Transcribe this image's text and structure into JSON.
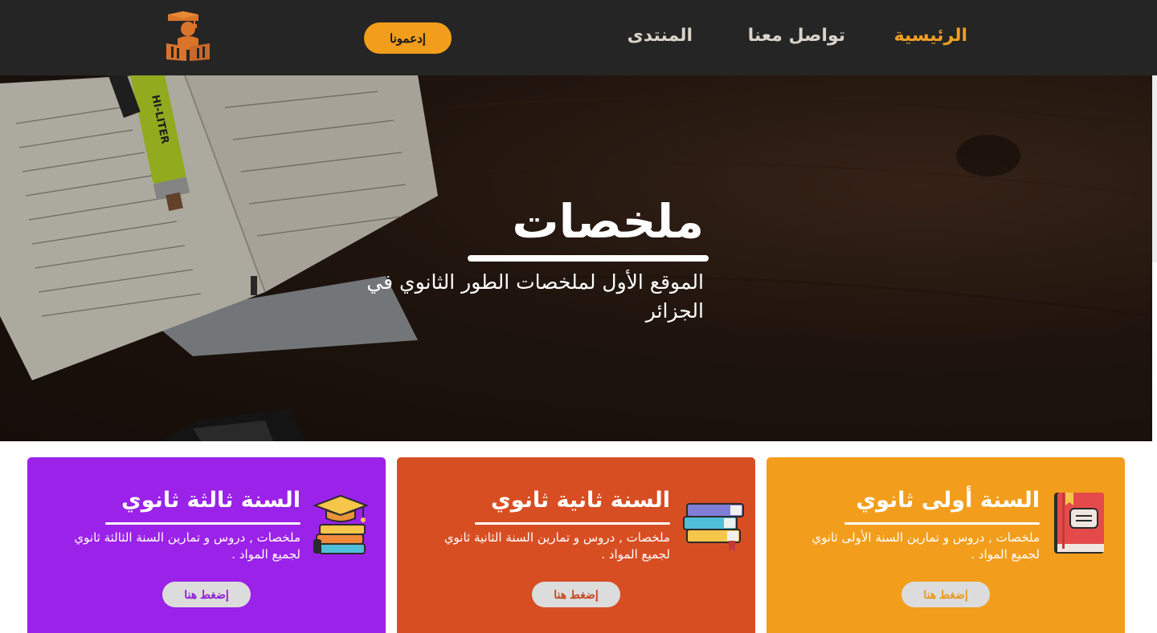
{
  "nav": {
    "home": "الرئيسية",
    "contact": "تواصل معنا",
    "forum": "المنتدى",
    "support_button": "إدعمونا",
    "logo_icon": "graduate-books-logo-icon"
  },
  "hero": {
    "title": "ملخصات",
    "subtitle": "الموقع الأول لملخصات الطور الثانوي في الجزائر",
    "highlighter_text": "HI-LITER"
  },
  "cards": [
    {
      "title": "السنة أولى ثانوي",
      "description": "ملخصات , دروس و تمارين السنة الأولى ثانوي لجميع المواد .",
      "button": "إضغط هنا",
      "icon": "book-icon",
      "color": "#f29e1c"
    },
    {
      "title": "السنة ثانية ثانوي",
      "description": "ملخصات , دروس و تمارين السنة الثانية ثانوي لجميع المواد .",
      "button": "إضغط هنا",
      "icon": "books-stack-icon",
      "color": "#d84e23"
    },
    {
      "title": "السنة ثالثة ثانوي",
      "description": "ملخصات , دروس و تمارين السنة الثالثة ثانوي لجميع المواد .",
      "button": "إضغط هنا",
      "icon": "graduation-cap-books-icon",
      "color": "#9b22e8"
    }
  ],
  "colors": {
    "accent": "#f29e1c",
    "nav_background": "#252525",
    "nav_text": "#d9d3c9"
  }
}
